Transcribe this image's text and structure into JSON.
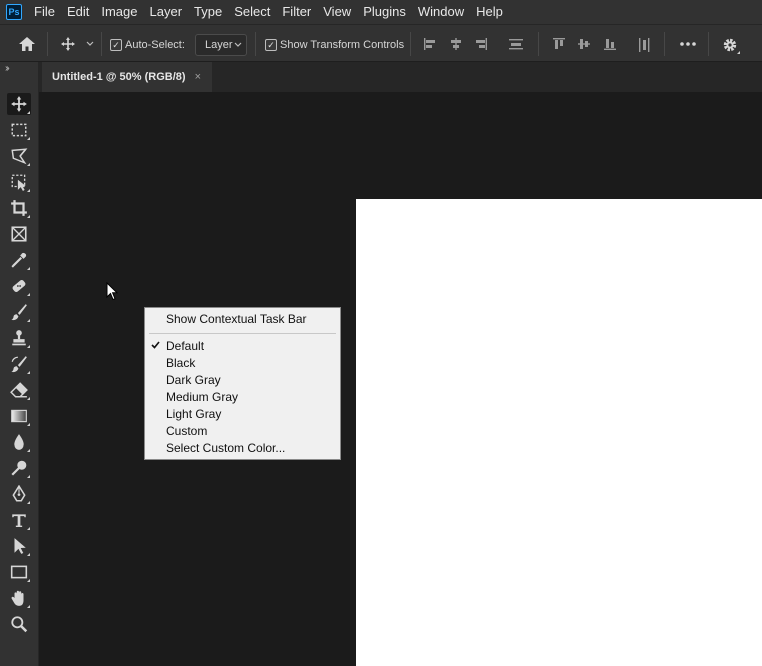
{
  "app": {
    "logo_text": "Ps"
  },
  "menubar": {
    "items": [
      "File",
      "Edit",
      "Image",
      "Layer",
      "Type",
      "Select",
      "Filter",
      "View",
      "Plugins",
      "Window",
      "Help"
    ]
  },
  "options": {
    "auto_select_label": "Auto-Select:",
    "auto_select_checked": true,
    "layer_select_value": "Layer",
    "show_transform_label": "Show Transform Controls",
    "show_transform_checked": true,
    "more_icon": "ellipsis-icon",
    "settings_icon": "gear-icon"
  },
  "document": {
    "tab_title": "Untitled-1 @ 50% (RGB/8)",
    "tab_close": "×",
    "canvas_color": "#ffffff",
    "workspace_color": "#1b1b1b"
  },
  "tools": [
    "move",
    "marquee",
    "lasso",
    "object-selection",
    "crop",
    "frame",
    "eyedropper",
    "healing-brush",
    "brush",
    "clone-stamp",
    "history-brush",
    "eraser",
    "gradient",
    "blur",
    "dodge",
    "pen",
    "type",
    "path-selection",
    "rectangle",
    "hand",
    "zoom"
  ],
  "context_menu": {
    "top_item": "Show Contextual Task Bar",
    "items": [
      "Default",
      "Black",
      "Dark Gray",
      "Medium Gray",
      "Light Gray",
      "Custom",
      "Select Custom Color..."
    ],
    "checked": "Default"
  },
  "colors": {
    "panel": "#323232",
    "menu_bg": "#f0f0f0",
    "accent": "#31a8ff"
  }
}
